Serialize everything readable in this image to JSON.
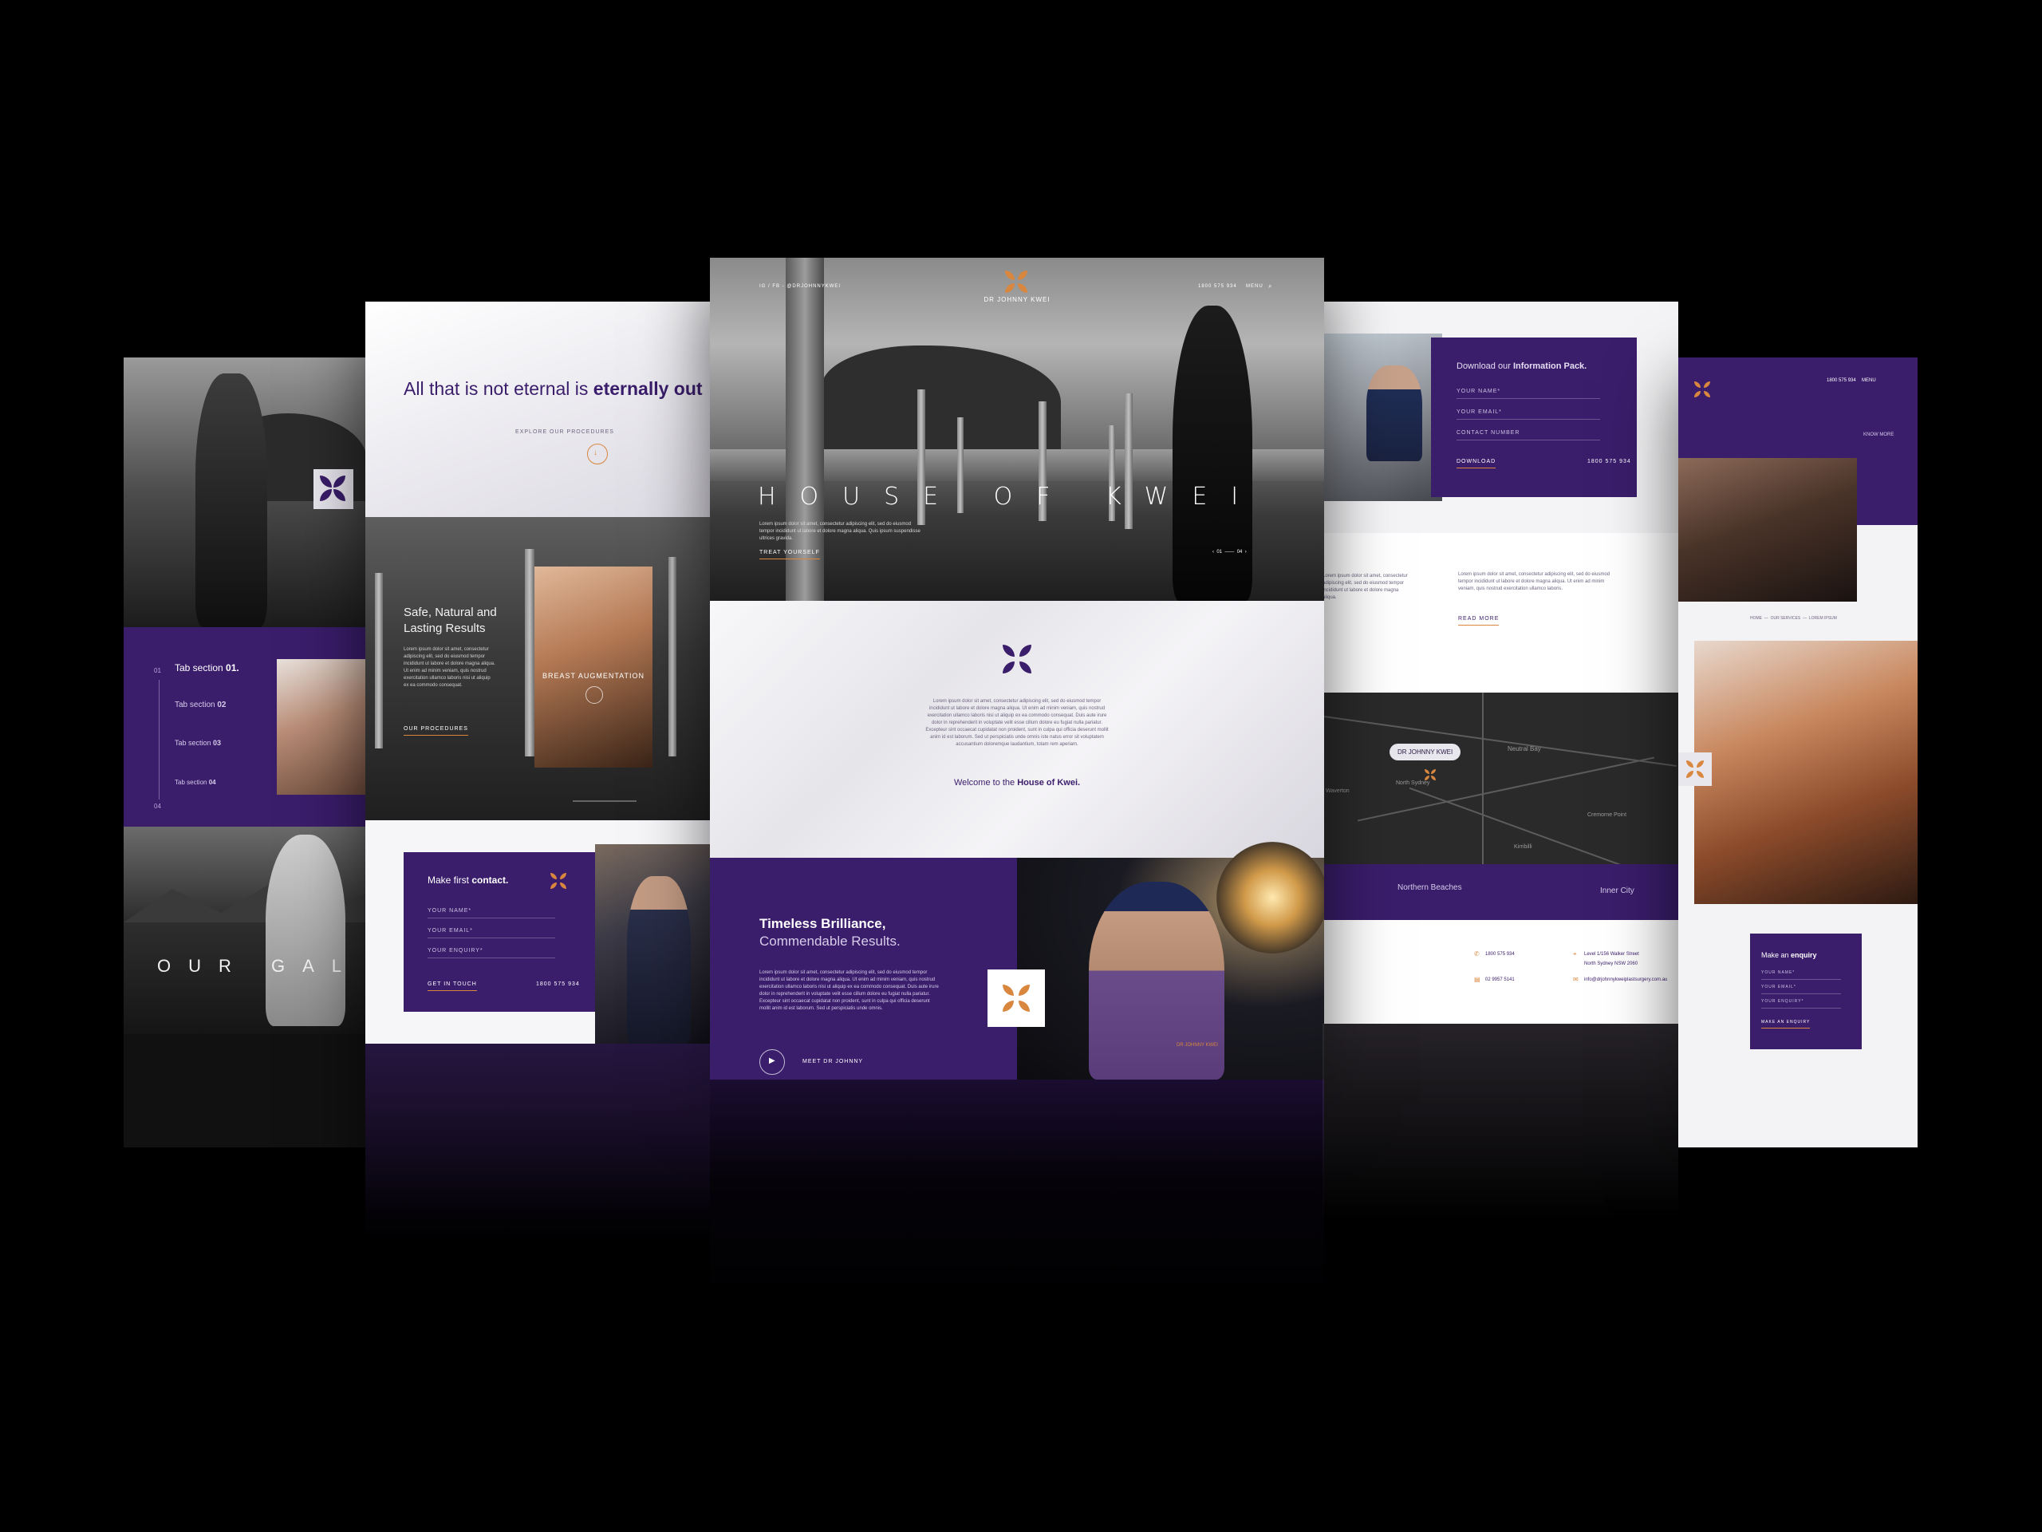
{
  "brand": {
    "name": "DR JOHNNY KWEI",
    "social": "IG / FB - @DRJOHNNYKWEI",
    "phone": "1800 575 934",
    "menu": "MENU"
  },
  "hero": {
    "title": "HOUSE OF KWEI",
    "body": "Lorem ipsum dolor sit amet, consectetur adipiscing elit, sed do eiusmod tempor incididunt ut labore et dolore magna aliqua. Quis ipsum suspendisse ultrices gravida.",
    "cta": "TREAT YOURSELF",
    "slide_current": "01",
    "slide_total": "04"
  },
  "welcome": {
    "body": "Lorem ipsum dolor sit amet, consectetur adipiscing elit, sed do eiusmod tempor incididunt ut labore et dolore magna aliqua. Ut enim ad minim veniam, quis nostrud exercitation ullamco laboris nisi ut aliquip ex ea commodo consequat. Duis aute irure dolor in reprehenderit in voluptate velit esse cillum dolore eu fugiat nulla pariatur. Excepteur sint occaecat cupidatat non proident, sunt in culpa qui officia deserunt mollit anim id est laborum. Sed ut perspiciatis unde omnis iste natus error sit voluptatem accusantium doloremque laudantium, totam rem aperiam.",
    "tagline_prefix": "Welcome to the ",
    "tagline_bold": "House of Kwei."
  },
  "timeless": {
    "title_line1": "Timeless Brilliance,",
    "title_line2": "Commendable Results.",
    "body": "Lorem ipsum dolor sit amet, consectetur adipiscing elit, sed do eiusmod tempor incididunt ut labore et dolore magna aliqua. Ut enim ad minim veniam, quis nostrud exercitation ullamco laboris nisi ut aliquip ex ea commodo consequat. Duis aute irure dolor in reprehenderit in voluptate velit esse cillum dolore eu fugiat nulla pariatur. Excepteur sint occaecat cupidatat non proident, sunt in culpa qui officia deserunt mollit anim id est laborum. Sed ut perspiciatis unde omnis.",
    "cta": "MEET DR JOHNNY",
    "scrubs_label": "DR JOHNNY KWEI"
  },
  "left2": {
    "headline_normal": "All that is not eternal is ",
    "headline_bold": "eternally out",
    "explore": "EXPLORE OUR PROCEDURES",
    "safe_title_1": "Safe, Natural and",
    "safe_title_2": "Lasting Results",
    "safe_body": "Lorem ipsum dolor sit amet, consectetur adipiscing elit, sed do eiusmod tempor incididunt ut labore et dolore magna aliqua. Ut enim ad minim veniam, quis nostrud exercitation ullamco laboris nisi ut aliquip ex ea commodo consequat.",
    "procedures": "OUR PROCEDURES",
    "card_label": "BREAST AUGMENTATION",
    "contact_title_normal": "Make first ",
    "contact_title_bold": "contact.",
    "field_name": "YOUR NAME*",
    "field_email": "YOUR EMAIL*",
    "field_enquiry": "YOUR ENQUIRY*",
    "get_in_touch": "GET IN TOUCH",
    "phone": "1800 575 934"
  },
  "left1": {
    "tab1": "Tab section ",
    "tab1_bold": "01.",
    "tab2": "Tab section ",
    "tab2_bold": "02",
    "tab3": "Tab section ",
    "tab3_bold": "03",
    "tab4": "Tab section ",
    "tab4_bold": "04",
    "tab_num_top": "01",
    "tab_num_bottom": "04",
    "gallery": "OUR GAL"
  },
  "right1": {
    "download_normal": "Download our ",
    "download_bold": "Information Pack.",
    "field_name": "YOUR NAME*",
    "field_email": "YOUR EMAIL*",
    "field_contact": "CONTACT NUMBER",
    "download": "DOWNLOAD",
    "phone": "1800 575 934",
    "text_body_left": "Lorem ipsum dolor sit amet, consectetur adipiscing elit, sed do eiusmod tempor incididunt ut labore et dolore magna aliqua.",
    "text_body_right": "Lorem ipsum dolor sit amet, consectetur adipiscing elit, sed do eiusmod tempor incididunt ut labore et dolore magna aliqua. Ut enim ad minim veniam, quis nostrud exercitation ullamco laboris.",
    "read_more": "READ MORE",
    "map_pin": "DR JOHNNY KWEI",
    "map_labels": [
      "Neutral Bay",
      "North Sydney",
      "Waverton",
      "Cremorne Point",
      "Kirribilli"
    ],
    "region_left": "Northern Beaches",
    "region_right": "Inner City",
    "contact_phone": "1800 575 934",
    "contact_fax": "02 9957 5141",
    "contact_address_1": "Level 1/156 Walker Street",
    "contact_address_2": "North Sydney NSW 2060",
    "contact_email": "info@drjohnnykweiplastsurgery.com.au"
  },
  "right2": {
    "phone": "1800 575 934",
    "menu": "MENU",
    "know_more": "KNOW MORE",
    "breadcrumb": [
      "HOME",
      "OUR SERVICES",
      "LOREM IPSUM"
    ],
    "enquiry_title_normal": "Make an ",
    "enquiry_title_bold": "enquiry",
    "field_name": "YOUR NAME*",
    "field_email": "YOUR EMAIL*",
    "field_enquiry": "YOUR ENQUIRY*",
    "submit": "MAKE AN ENQUIRY"
  },
  "icons": [
    "logo-mark-icon",
    "play-icon",
    "arrow-down-icon",
    "search-icon",
    "phone-icon",
    "fax-icon",
    "pin-icon",
    "mail-icon"
  ],
  "colors": {
    "background": "#000000",
    "purple": "#3a1d6b",
    "orange": "#d9873f",
    "light": "#f3f2f5"
  }
}
